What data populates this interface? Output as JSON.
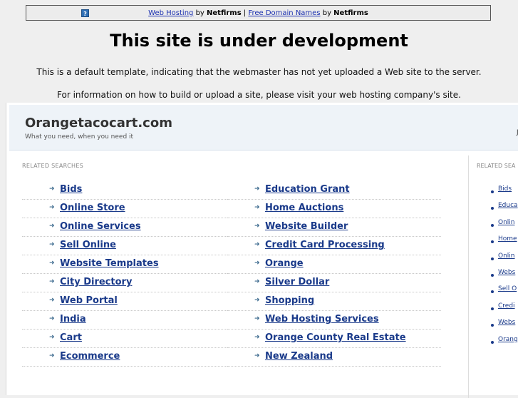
{
  "topbar": {
    "link1": "Web Hosting",
    "by1": "by",
    "brand1": "Netfirms",
    "sep": "|",
    "link2": "Free Domain Names",
    "by2": "by",
    "brand2": "Netfirms",
    "help_icon": "question-icon"
  },
  "main": {
    "title": "This site is under development",
    "para1": "This is a default template, indicating that the webmaster has not yet uploaded a Web site to the server.",
    "para2": "For information on how to build or upload a site, please visit your web hosting company's site."
  },
  "frame": {
    "domain": "Orangetacocart.com",
    "tagline": "What you need, when you need it",
    "header_right_fragment": "Ju",
    "related_title": "RELATED SEARCHES",
    "left_items": [
      "Bids",
      "Online Store",
      "Online Services",
      "Sell Online",
      "Website Templates",
      "City Directory",
      "Web Portal",
      "India",
      "Cart",
      "Ecommerce"
    ],
    "right_items": [
      "Education Grant",
      "Home Auctions",
      "Website Builder",
      "Credit Card Processing",
      "Orange",
      "Silver Dollar",
      "Shopping",
      "Web Hosting Services",
      "Orange County Real Estate",
      "New Zealand"
    ],
    "side_title": "RELATED SEA",
    "side_items": [
      "Bids",
      "Educa",
      "Onlin",
      "Home",
      "Onlin",
      "Webs",
      "Sell O",
      "Credi",
      "Webs",
      "Orang"
    ],
    "arrow_icon": "arrow-right-icon",
    "bullet_icon": "bullet-icon"
  }
}
